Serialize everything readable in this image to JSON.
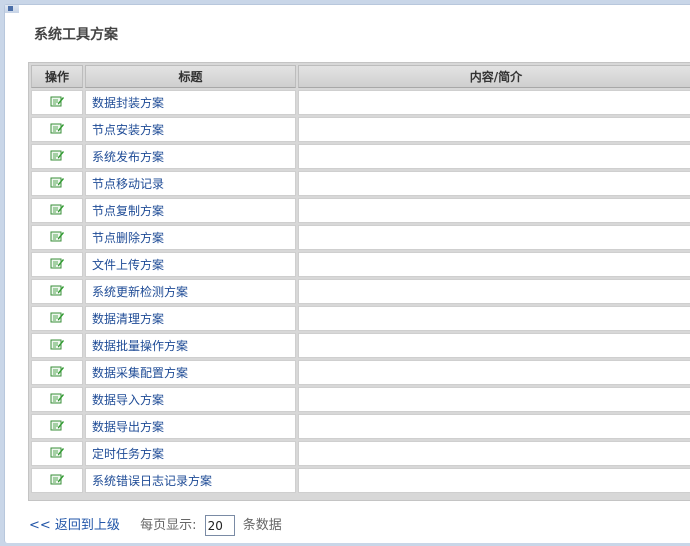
{
  "page": {
    "title": "系统工具方案"
  },
  "table": {
    "headers": {
      "op": "操作",
      "title": "标题",
      "content": "内容/简介"
    },
    "rows": [
      {
        "title": "数据封装方案",
        "content": ""
      },
      {
        "title": "节点安装方案",
        "content": ""
      },
      {
        "title": "系统发布方案",
        "content": ""
      },
      {
        "title": "节点移动记录",
        "content": ""
      },
      {
        "title": "节点复制方案",
        "content": ""
      },
      {
        "title": "节点删除方案",
        "content": ""
      },
      {
        "title": "文件上传方案",
        "content": ""
      },
      {
        "title": "系统更新检测方案",
        "content": ""
      },
      {
        "title": "数据清理方案",
        "content": ""
      },
      {
        "title": "数据批量操作方案",
        "content": ""
      },
      {
        "title": "数据采集配置方案",
        "content": ""
      },
      {
        "title": "数据导入方案",
        "content": ""
      },
      {
        "title": "数据导出方案",
        "content": ""
      },
      {
        "title": "定时任务方案",
        "content": ""
      },
      {
        "title": "系统错误日志记录方案",
        "content": ""
      }
    ],
    "row_icon": "edit-icon"
  },
  "footer": {
    "back_label": "<< 返回到上级",
    "per_page_label": "每页显示:",
    "per_page_value": "20",
    "unit_label": "条数据"
  },
  "colors": {
    "link": "#1e4b96",
    "background": "#c9d6e8",
    "icon_green": "#2e9a2e"
  }
}
